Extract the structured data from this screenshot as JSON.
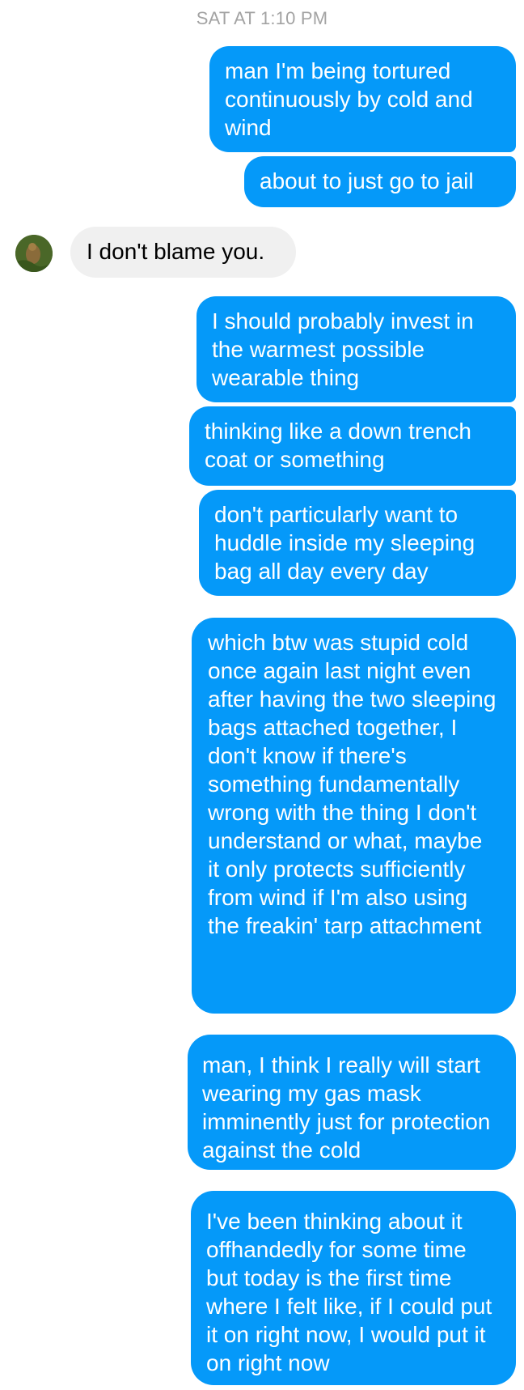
{
  "timestamp": "SAT AT 1:10 PM",
  "messages": [
    {
      "from": "me",
      "text": "man I'm being tortured continuously by cold and wind"
    },
    {
      "from": "me",
      "text": "about to just go to jail"
    },
    {
      "from": "them",
      "text": "I don't blame you."
    },
    {
      "from": "me",
      "text": "I should probably invest in the warmest possible wearable thing"
    },
    {
      "from": "me",
      "text": "thinking like a down trench coat or something"
    },
    {
      "from": "me",
      "text": "don't particularly want to huddle inside my sleeping bag all day every day"
    },
    {
      "from": "me",
      "text": "which btw was stupid cold once again last night even after having the two sleeping bags attached together, I don't know if there's something fundamentally wrong with the thing I don't understand or what, maybe it only protects sufficiently from wind if I'm also using the freakin' tarp attachment"
    },
    {
      "from": "me",
      "text": "man, I think I really will start wearing my gas mask imminently just for protection against the cold"
    },
    {
      "from": "me",
      "text": "I've been thinking about it offhandedly for some time but today is the first time where I felt like, if I could put it on right now, I would put it on right now"
    }
  ],
  "colors": {
    "outgoing_bubble": "#0599f9",
    "incoming_bubble": "#f0f0f0",
    "timestamp": "#a3a3a3"
  },
  "icons": {
    "avatar": "contact-avatar-photo"
  }
}
